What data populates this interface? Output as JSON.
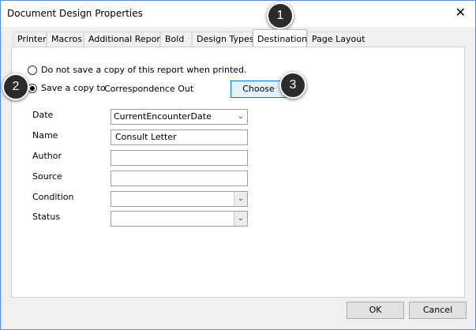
{
  "window": {
    "title": "Document Design Properties",
    "close_glyph": "✕"
  },
  "tabs": [
    {
      "label": "Printer"
    },
    {
      "label": "Macros"
    },
    {
      "label": "Additional Reports"
    },
    {
      "label": "Bold"
    },
    {
      "label": "Design Types"
    },
    {
      "label": "Destination",
      "active": true
    },
    {
      "label": "Page Layout"
    }
  ],
  "destination": {
    "option_no_save": "Do not save a copy of this report when printed.",
    "option_save": "Save a copy to",
    "save_location": "Correspondence Out",
    "choose_label": "Choose",
    "selected_option": "save"
  },
  "fields": {
    "date": {
      "label": "Date",
      "value": "CurrentEncounterDate"
    },
    "name": {
      "label": "Name",
      "value": "Consult Letter"
    },
    "author": {
      "label": "Author",
      "value": ""
    },
    "source": {
      "label": "Source",
      "value": ""
    },
    "condition": {
      "label": "Condition",
      "value": ""
    },
    "status": {
      "label": "Status",
      "value": ""
    }
  },
  "footer": {
    "ok_label": "OK",
    "cancel_label": "Cancel"
  },
  "annotations": {
    "badge1": "1",
    "badge2": "2",
    "badge3": "3"
  },
  "icons": {
    "close": "close-icon",
    "dropdown": "chevron-down-icon",
    "radio": "radio-button"
  },
  "colors": {
    "accent": "#0078d7",
    "window_border": "#5a8bd6",
    "badge": "#2b2b2b"
  }
}
